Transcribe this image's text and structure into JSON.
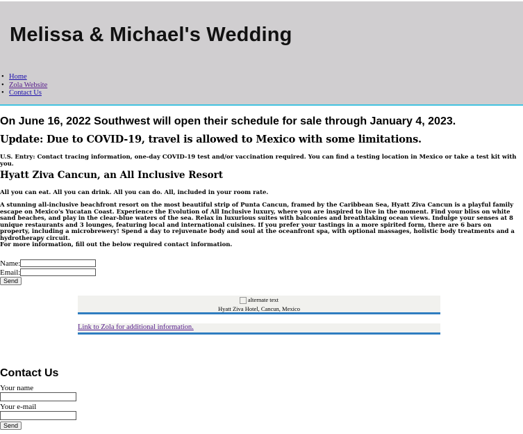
{
  "header": {
    "title": "Melissa & Michael's Wedding",
    "nav": [
      {
        "label": "Home"
      },
      {
        "label": "Zola Website"
      },
      {
        "label": "Contact Us"
      }
    ],
    "accent_color": "#43c3e0",
    "background_color": "#d0ced0"
  },
  "main": {
    "sale_heading": "On June 16, 2022 Southwest will open their schedule for sale through January 4, 2023.",
    "update_heading": "Update: Due to COVID-19, travel is allowed to Mexico with some limitations.",
    "entry_text": "U.S. Entry: Contact tracing information, one-day COVID-19 test and/or vaccination required. You can find a testing location in Mexico or take a test kit with you.",
    "resort_heading": "Hyatt Ziva Cancun, an All Inclusive Resort",
    "eat_text": "All you can eat. All you can drink. All you can do. All, included in your room rate.",
    "description": "A stunning all-inclusive beachfront resort on the most beautiful strip of Punta Cancun, framed by the Caribbean Sea, Hyatt Ziva Cancun is a playful family escape on Mexico's Yucatan Coast. Experience the Evolution of All Inclusive luxury, where you are inspired to live in the moment. Find your bliss on white sand beaches, and play in the clear-blue waters of the sea. Relax in luxurious suites with balconies and breathtaking ocean views. Indulge your senses at 8 unique restaurants and 3 lounges, featuring local and international cuisines. If you prefer your tastings in a more spirited form, there are 6 bars on property, including a microbrewery! Spend a day to rejuvenate body and soul at the oceanfront spa, with optional massages, holistic body treatments and a hydrotherapy circuit.",
    "more_info": "For more information, fill out the below required contact information.",
    "form": {
      "name_label": "Name:",
      "name_value": "",
      "email_label": "Email:",
      "email_value": "",
      "send_label": "Send"
    },
    "figure": {
      "alt_text": "alternate text",
      "caption": "Hyatt Ziva Hotel, Cancun, Mexico"
    },
    "zola_link": "Link to Zola for additional information."
  },
  "contact": {
    "heading": "Contact Us",
    "name_label": "Your name",
    "name_value": "",
    "email_label": "Your e-mail",
    "email_value": "",
    "send_label": "Send"
  }
}
